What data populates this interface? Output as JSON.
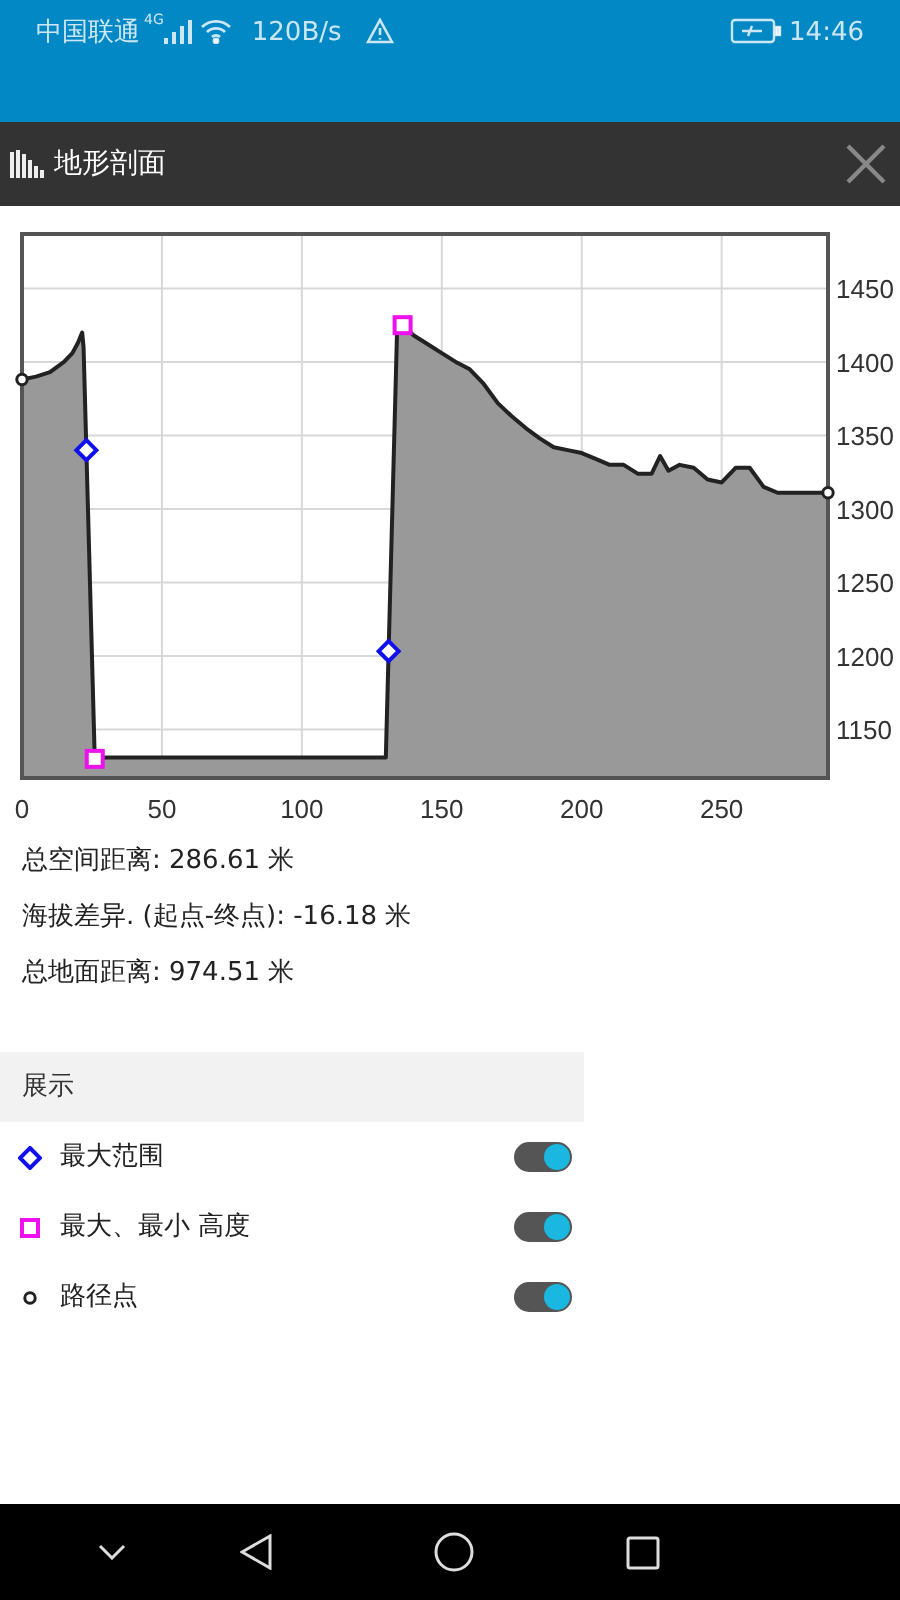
{
  "status_bar": {
    "carrier": "中国联通",
    "network": "4G",
    "speed": "120B/s",
    "time": "14:46"
  },
  "title_bar": {
    "title": "地形剖面"
  },
  "profile": {
    "chart_data": {
      "type": "area",
      "grid": true,
      "x": [
        0,
        5,
        10,
        15,
        18,
        20,
        21.5,
        22,
        26,
        30,
        130,
        134,
        136,
        140,
        145,
        150,
        155,
        160,
        165,
        170,
        175,
        180,
        185,
        190,
        195,
        200,
        205,
        210,
        215,
        220,
        225,
        228,
        231,
        235,
        240,
        245,
        250,
        255,
        260,
        265,
        270,
        288
      ],
      "series": [
        {
          "color": "#999999",
          "values": [
            1388,
            1390,
            1393,
            1400,
            1406,
            1413,
            1420,
            1410,
            1130,
            1131,
            1131,
            1420,
            1425,
            1418,
            1412,
            1406,
            1400,
            1395,
            1385,
            1372,
            1363,
            1355,
            1348,
            1342,
            1340,
            1338,
            1334,
            1330,
            1330,
            1324,
            1324,
            1336,
            1326,
            1330,
            1328,
            1320,
            1318,
            1328,
            1328,
            1315,
            1311,
            1311
          ]
        }
      ],
      "xlim": [
        0,
        288
      ],
      "ylim": [
        1117,
        1487
      ],
      "xticks": [
        0,
        50,
        100,
        150,
        200,
        250
      ],
      "yticks": [
        1150,
        1200,
        1250,
        1300,
        1350,
        1400,
        1450
      ]
    }
  },
  "stats": [
    "总空间距离: 286.61 米",
    "海拔差异. (起点-终点): -16.18 米",
    "总地面距离: 974.51 米"
  ],
  "display_section": {
    "title": "展示",
    "items": [
      {
        "kind": "diamond",
        "label": "最大范围",
        "on": true
      },
      {
        "kind": "square",
        "label": "最大、最小 高度",
        "on": true
      },
      {
        "kind": "circle",
        "label": "路径点",
        "on": true
      }
    ]
  }
}
